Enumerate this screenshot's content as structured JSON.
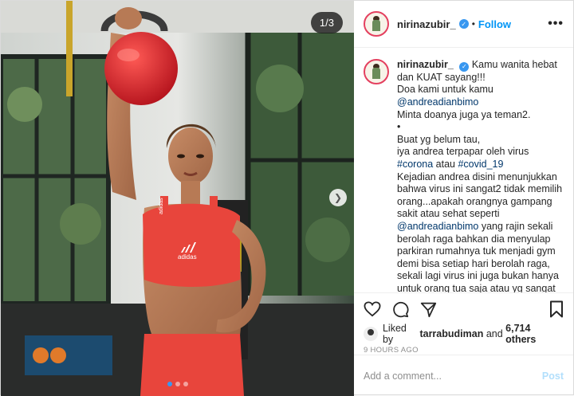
{
  "media": {
    "counter": "1/3",
    "next_icon": "chevron-right-icon",
    "shirt_brand": "adidas",
    "strap_text": "adidas",
    "dots_total": 3,
    "dots_active": 1
  },
  "header": {
    "username": "nirinazubir_",
    "separator": "•",
    "follow_label": "Follow",
    "more_label": "•••"
  },
  "caption": {
    "username": "nirinazubir_",
    "lines": [
      "Kamu wanita hebat",
      "dan KUAT sayang!!!",
      "Doa kami untuk kamu",
      "@andreadianbimo",
      "Minta doanya juga ya teman2.",
      "•",
      "Buat yg belum tau,",
      "iya andrea terpapar oleh virus",
      "#corona atau #covid_19",
      "Kejadian andrea disini menunjukkan",
      "bahwa virus ini sangat2 tidak memilih",
      "orang...apakah orangnya gampang",
      "sakit atau sehat seperti",
      "@andreadianbimo yang rajin sekali",
      "berolah raga bahkan dia menyulap",
      "parkiran rumahnya tuk menjadi gym",
      "demi bisa setiap hari berolah raga,",
      "sekali lagi virus ini juga bukan hanya",
      "untuk orang tua saja atau yg sangat"
    ],
    "first_line": "Kamu wanita hebat",
    "mention": "@andreadianbimo",
    "tag_corona": "#corona",
    "tag_word": " atau ",
    "tag_covid": "#covid_19",
    "mention2_rest": " yang rajin sekali"
  },
  "actions": {
    "like_icon": "heart-icon",
    "comment_icon": "comment-icon",
    "share_icon": "share-icon",
    "save_icon": "bookmark-icon"
  },
  "likes": {
    "prefix": "Liked by ",
    "user": "tarrabudiman",
    "middle": " and ",
    "others": "6,714 others"
  },
  "timestamp": "9 HOURS AGO",
  "comment": {
    "placeholder": "Add a comment...",
    "post_label": "Post"
  },
  "colors": {
    "accent": "#0095f6",
    "link": "#00376b",
    "muted": "#8e8e8e",
    "kettlebell": "#e0232e",
    "outfit": "#e8453c"
  }
}
